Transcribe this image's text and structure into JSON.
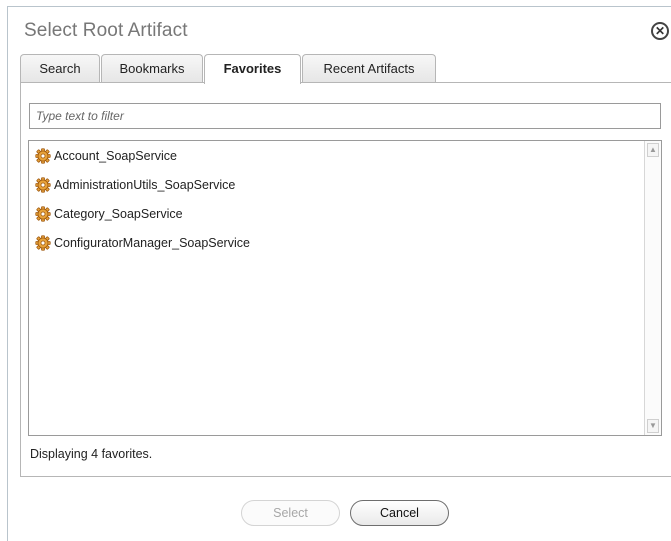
{
  "dialog": {
    "title": "Select Root Artifact"
  },
  "tabs": [
    {
      "label": "Search",
      "active": false
    },
    {
      "label": "Bookmarks",
      "active": false
    },
    {
      "label": "Favorites",
      "active": true
    },
    {
      "label": "Recent Artifacts",
      "active": false
    }
  ],
  "filter": {
    "placeholder": "Type text to filter",
    "value": ""
  },
  "favorites": [
    {
      "label": "Account_SoapService",
      "icon": "gear-icon"
    },
    {
      "label": "AdministrationUtils_SoapService",
      "icon": "gear-icon"
    },
    {
      "label": "Category_SoapService",
      "icon": "gear-icon"
    },
    {
      "label": "ConfiguratorManager_SoapService",
      "icon": "gear-icon"
    }
  ],
  "status": "Displaying 4 favorites.",
  "buttons": {
    "select_label": "Select",
    "select_enabled": false,
    "cancel_label": "Cancel"
  },
  "colors": {
    "gear_fill": "#e8a33a",
    "gear_stroke": "#a05a10"
  }
}
